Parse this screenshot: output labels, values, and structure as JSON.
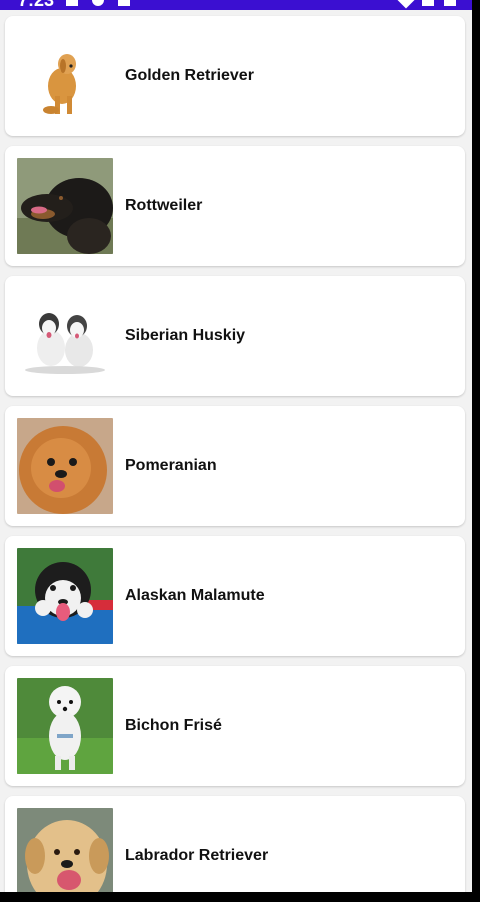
{
  "status_bar": {
    "time": "7:23"
  },
  "breeds": [
    {
      "name": "Golden Retriever",
      "image": "golden-retriever-photo"
    },
    {
      "name": "Rottweiler",
      "image": "rottweiler-photo"
    },
    {
      "name": "Siberian Huskiy",
      "image": "siberian-husky-photo"
    },
    {
      "name": "Pomeranian",
      "image": "pomeranian-photo"
    },
    {
      "name": "Alaskan Malamute",
      "image": "alaskan-malamute-photo"
    },
    {
      "name": "Bichon Frisé",
      "image": "bichon-frise-photo"
    },
    {
      "name": "Labrador Retriever",
      "image": "labrador-retriever-photo"
    }
  ],
  "colors": {
    "status_bar": "#3b0fd1",
    "card": "#ffffff",
    "background": "#f2f2f2"
  }
}
